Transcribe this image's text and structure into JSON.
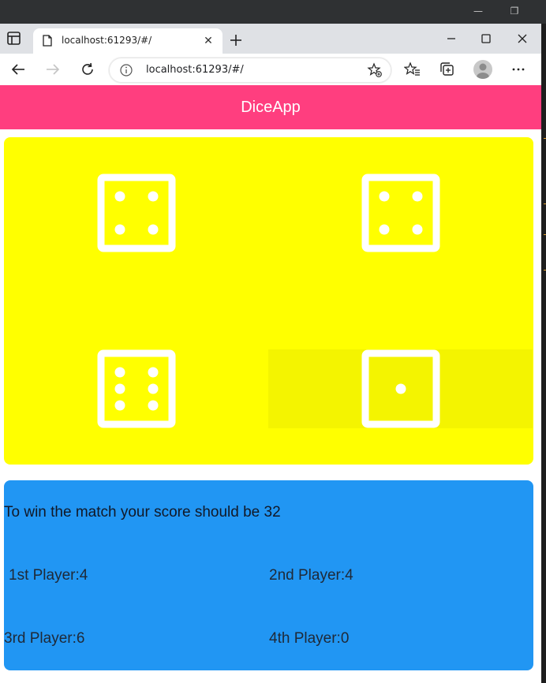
{
  "browser": {
    "tab_title": "localhost:61293/#/",
    "tab_close": "✕",
    "address": "localhost:61293/#/"
  },
  "app": {
    "title": "DiceApp"
  },
  "dice": [
    {
      "player": "1st",
      "value": 4
    },
    {
      "player": "2nd",
      "value": 4
    },
    {
      "player": "3rd",
      "value": 6
    },
    {
      "player": "4th",
      "value": 1
    }
  ],
  "scoreboard": {
    "target_text": "To win the match your score should be 32",
    "players": [
      {
        "label": "1st Player:4"
      },
      {
        "label": "2nd Player:4"
      },
      {
        "label": "3rd Player:6"
      },
      {
        "label": "4th Player:0"
      }
    ]
  },
  "colors": {
    "appbar": "#ff3e7f",
    "dice_card": "#ffff00",
    "info_card": "#2196f3",
    "die": "#ffffff"
  }
}
